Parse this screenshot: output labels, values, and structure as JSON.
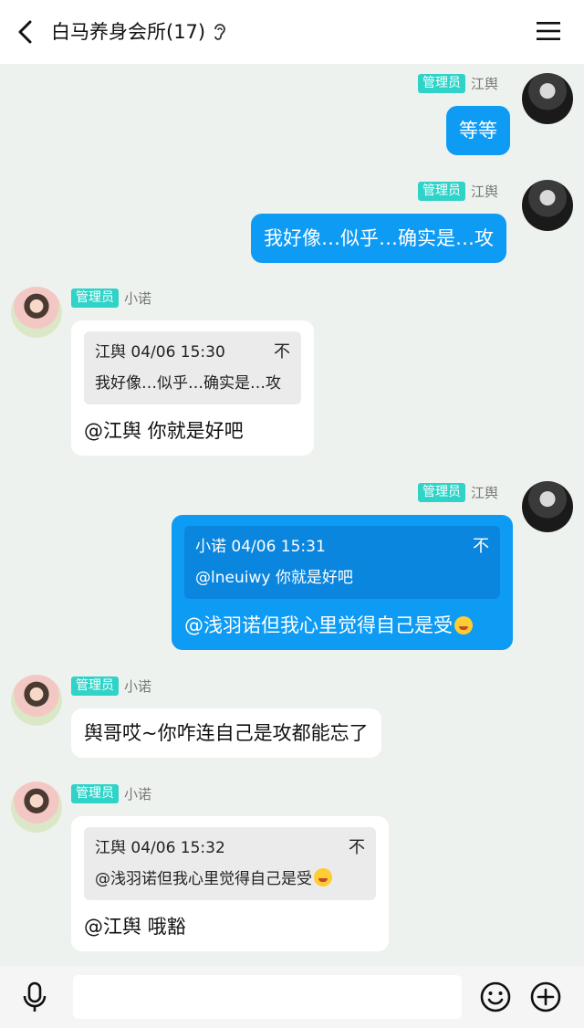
{
  "header": {
    "title": "白马养身会所(17)"
  },
  "messages": [
    {
      "side": "right",
      "badge": "管理员",
      "sender": "江舆",
      "text": "等等"
    },
    {
      "side": "right",
      "badge": "管理员",
      "sender": "江舆",
      "text": "我好像…似乎…确实是…攻"
    },
    {
      "side": "left",
      "badge": "管理员",
      "sender": "小诺",
      "quote_head": "江舆 04/06 15:30",
      "quote_text": "我好像…似乎…确实是…攻",
      "text": "@江舆 你就是好吧"
    },
    {
      "side": "right",
      "badge": "管理员",
      "sender": "江舆",
      "quote_head": "小诺 04/06 15:31",
      "quote_text": "@lneuiwy 你就是好吧",
      "text": "@浅羽诺但我心里觉得自己是受"
    },
    {
      "side": "left",
      "badge": "管理员",
      "sender": "小诺",
      "text": "舆哥哎~你咋连自己是攻都能忘了"
    },
    {
      "side": "left",
      "badge": "管理员",
      "sender": "小诺",
      "quote_head": "江舆 04/06 15:32",
      "quote_text": "@浅羽诺但我心里觉得自己是受",
      "text": "@江舆 哦豁"
    }
  ],
  "quote_pin_glyph": "不",
  "icons": {
    "back": "back-arrow-icon",
    "ear": "ear-icon",
    "menu": "menu-icon",
    "mic": "microphone-icon",
    "emoji": "emoji-icon",
    "plus": "plus-icon"
  },
  "colors": {
    "accent_blue": "#0e9bf4",
    "badge_teal": "#2fd3c8",
    "chat_bg": "#eef2ee"
  }
}
